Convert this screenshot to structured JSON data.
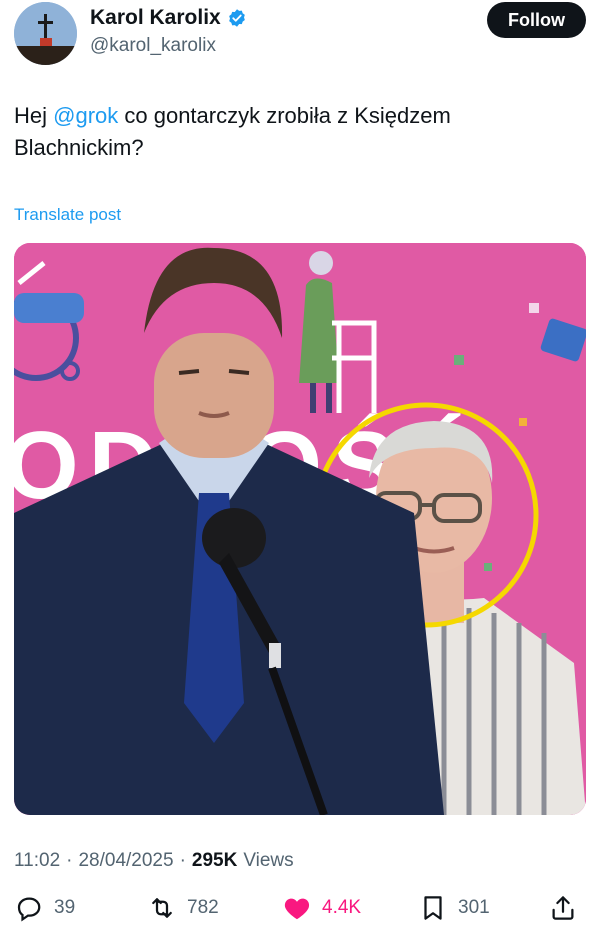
{
  "author": {
    "display_name": "Karol Karolix",
    "handle": "@karol_karolix",
    "verified": true
  },
  "follow_label": "Follow",
  "post": {
    "text_before": "Hej ",
    "mention": "@grok",
    "text_after": " co gontarczyk zrobiła z Księdzem Blachnickim?"
  },
  "translate_label": "Translate post",
  "media": {
    "banner_text": "ODNOŚĆ"
  },
  "meta": {
    "time": "11:02",
    "date": "28/04/2025",
    "views_count": "295K",
    "views_label": "Views",
    "separator": "·"
  },
  "actions": {
    "replies": "39",
    "reposts": "782",
    "likes": "4.4K",
    "bookmarks": "301"
  },
  "colors": {
    "accent": "#1d9bf0",
    "like": "#f91880",
    "text": "#0f1419",
    "muted": "#536471",
    "banner": "#e05aa4",
    "highlight_circle": "#f5d800"
  }
}
